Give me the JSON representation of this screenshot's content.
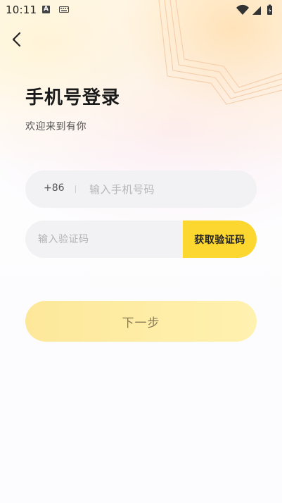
{
  "status_bar": {
    "time": "10:11",
    "input_badge": "A",
    "icons": [
      "input-method-icon",
      "keyboard-icon",
      "wifi-icon",
      "signal-icon",
      "battery-icon"
    ]
  },
  "header": {
    "back_icon": "chevron-left-icon"
  },
  "login": {
    "title": "手机号登录",
    "subtitle": "欢迎来到有你",
    "phone": {
      "country_code": "+86",
      "separator": "|",
      "placeholder": "输入手机号码",
      "value": ""
    },
    "code": {
      "placeholder": "输入验证码",
      "value": "",
      "get_code_label": "获取验证码"
    },
    "next_label": "下一步"
  },
  "colors": {
    "accent": "#fcd730",
    "next_button": "#fde89a",
    "field_bg": "#f2f2f4",
    "title_text": "#1a1a1a"
  }
}
